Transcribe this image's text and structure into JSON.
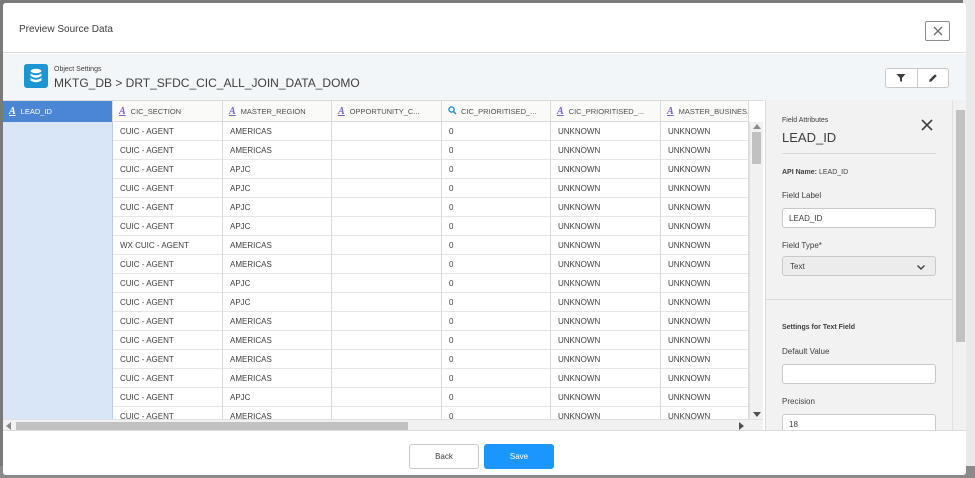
{
  "modal": {
    "title": "Preview Source Data"
  },
  "object": {
    "kicker": "Object Settings",
    "path": "MKTG_DB > DRT_SFDC_CIC_ALL_JOIN_DATA_DOMO"
  },
  "grid": {
    "columns": [
      {
        "label": "LEAD_ID",
        "type_icon": "text-type-icon",
        "active": true
      },
      {
        "label": "CIC_SECTION",
        "type_icon": "text-type-icon"
      },
      {
        "label": "MASTER_REGION",
        "type_icon": "text-type-icon"
      },
      {
        "label": "OPPORTUNITY_C...",
        "type_icon": "text-type-icon"
      },
      {
        "label": "CIC_PRIORITISED_...",
        "type_icon": "number-type-icon"
      },
      {
        "label": "CIC_PRIORITISED_...",
        "type_icon": "text-type-icon"
      },
      {
        "label": "MASTER_BUSINES...",
        "type_icon": "text-type-icon"
      }
    ],
    "rows": [
      [
        "",
        "CUIC - AGENT",
        "AMERICAS",
        "",
        "0",
        "UNKNOWN",
        "UNKNOWN"
      ],
      [
        "",
        "CUIC - AGENT",
        "AMERICAS",
        "",
        "0",
        "UNKNOWN",
        "UNKNOWN"
      ],
      [
        "",
        "CUIC - AGENT",
        "APJC",
        "",
        "0",
        "UNKNOWN",
        "UNKNOWN"
      ],
      [
        "",
        "CUIC - AGENT",
        "APJC",
        "",
        "0",
        "UNKNOWN",
        "UNKNOWN"
      ],
      [
        "",
        "CUIC - AGENT",
        "APJC",
        "",
        "0",
        "UNKNOWN",
        "UNKNOWN"
      ],
      [
        "",
        "CUIC - AGENT",
        "APJC",
        "",
        "0",
        "UNKNOWN",
        "UNKNOWN"
      ],
      [
        "",
        "WX CUIC - AGENT",
        "AMERICAS",
        "",
        "0",
        "UNKNOWN",
        "UNKNOWN"
      ],
      [
        "",
        "CUIC - AGENT",
        "AMERICAS",
        "",
        "0",
        "UNKNOWN",
        "UNKNOWN"
      ],
      [
        "",
        "CUIC - AGENT",
        "APJC",
        "",
        "0",
        "UNKNOWN",
        "UNKNOWN"
      ],
      [
        "",
        "CUIC - AGENT",
        "APJC",
        "",
        "0",
        "UNKNOWN",
        "UNKNOWN"
      ],
      [
        "",
        "CUIC - AGENT",
        "AMERICAS",
        "",
        "0",
        "UNKNOWN",
        "UNKNOWN"
      ],
      [
        "",
        "CUIC - AGENT",
        "AMERICAS",
        "",
        "0",
        "UNKNOWN",
        "UNKNOWN"
      ],
      [
        "",
        "CUIC - AGENT",
        "AMERICAS",
        "",
        "0",
        "UNKNOWN",
        "UNKNOWN"
      ],
      [
        "",
        "CUIC - AGENT",
        "AMERICAS",
        "",
        "0",
        "UNKNOWN",
        "UNKNOWN"
      ],
      [
        "",
        "CUIC - AGENT",
        "APJC",
        "",
        "0",
        "UNKNOWN",
        "UNKNOWN"
      ],
      [
        "",
        "CUIC - AGENT",
        "AMERICAS",
        "",
        "0",
        "UNKNOWN",
        "UNKNOWN"
      ]
    ]
  },
  "panel": {
    "kicker": "Field Attributes",
    "title": "LEAD_ID",
    "api_label": "API Name:",
    "api_value": "LEAD_ID",
    "field_label": "Field Label",
    "field_label_value": "LEAD_ID",
    "field_type_label": "Field Type*",
    "field_type_value": "Text",
    "section_title": "Settings for Text Field",
    "default_value_label": "Default Value",
    "default_value": "",
    "precision_label": "Precision",
    "precision_value": "18"
  },
  "footer": {
    "back_label": "Back",
    "save_label": "Save"
  },
  "colors": {
    "accent": "#1b96ff",
    "active_column": "#4a86d4",
    "selected_cell": "#d8e6f7",
    "object_icon": "#1b96d2",
    "type_icon": "#7a60c9"
  }
}
